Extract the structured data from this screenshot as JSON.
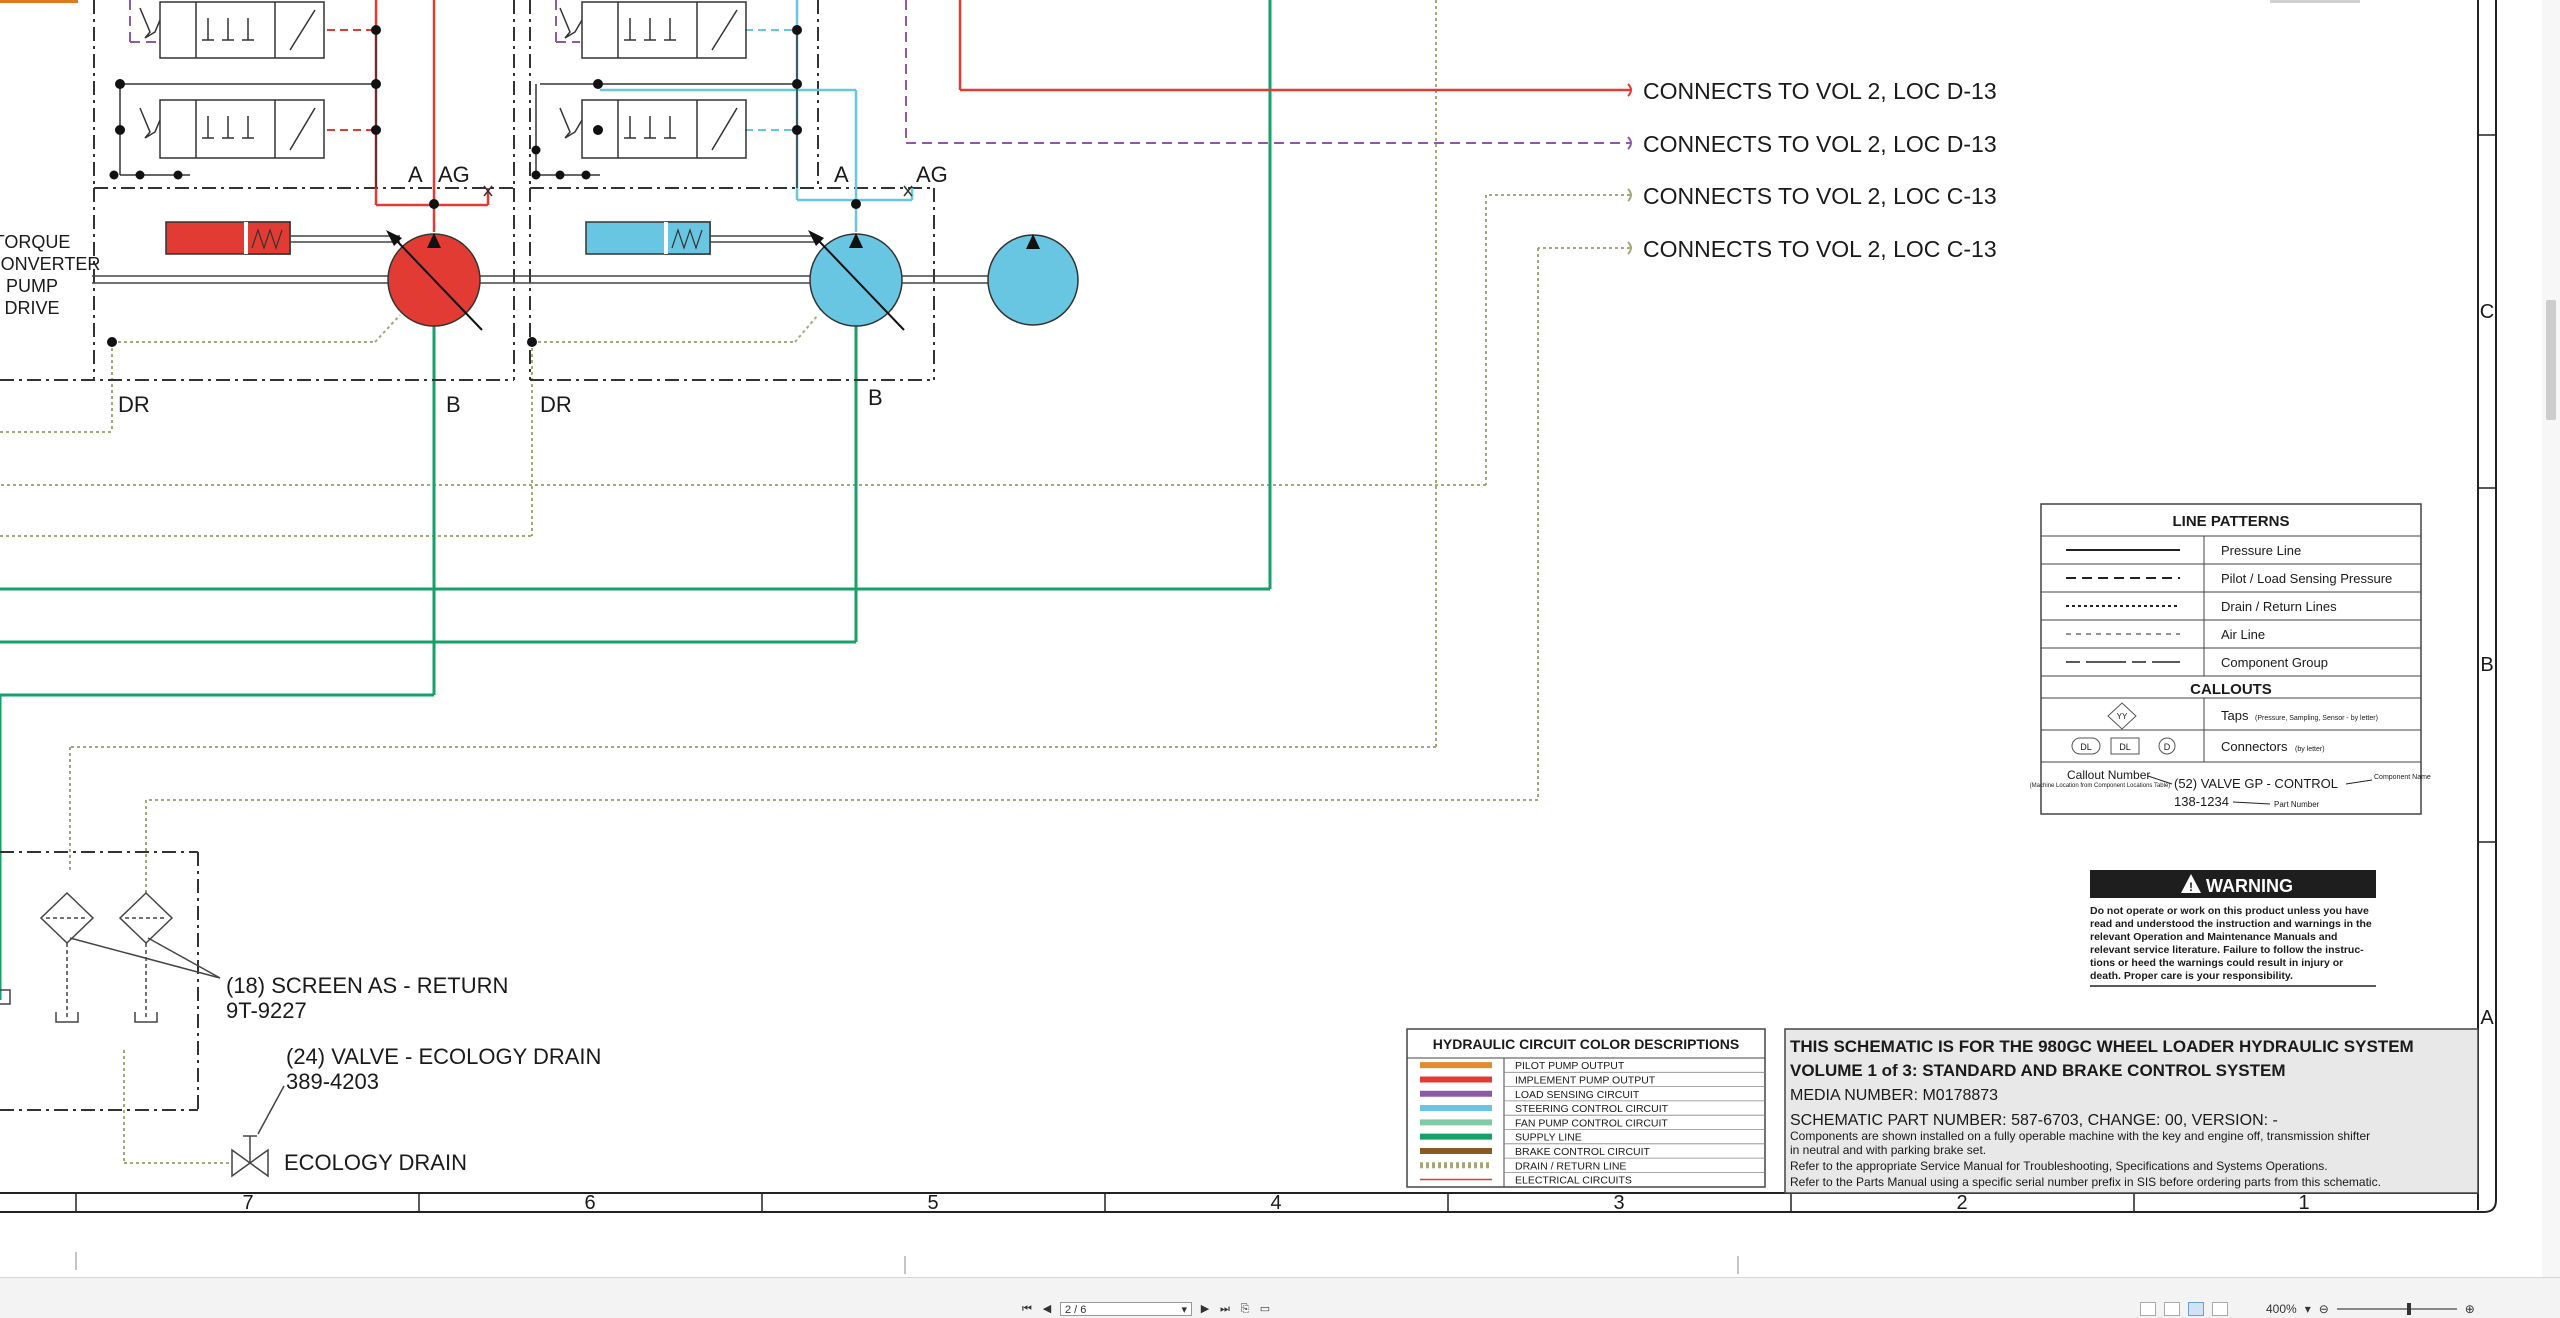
{
  "connects": [
    "CONNECTS TO VOL 2, LOC D-13",
    "CONNECTS TO VOL 2, LOC D-13",
    "CONNECTS TO VOL 2, LOC C-13",
    "CONNECTS TO VOL 2, LOC C-13"
  ],
  "ports": {
    "a1": "A",
    "ag1": "AG",
    "a2": "A",
    "ag2": "AG",
    "dr1": "DR",
    "dr2": "DR",
    "b1": "B",
    "b2": "B"
  },
  "torque": [
    "TORQUE",
    "CONVERTER",
    "PUMP",
    "DRIVE"
  ],
  "screen": {
    "name": "(18) SCREEN AS - RETURN",
    "part": "9T-9227"
  },
  "ecology_valve": {
    "name": "(24) VALVE - ECOLOGY DRAIN",
    "part": "389-4203"
  },
  "ecology_drain": "ECOLOGY DRAIN",
  "line_patterns": {
    "title": "LINE PATTERNS",
    "items": [
      "Pressure Line",
      "Pilot / Load Sensing Pressure",
      "Drain / Return Lines",
      "Air Line",
      "Component Group"
    ],
    "callouts_title": "CALLOUTS",
    "taps_label": "Taps",
    "taps_note": "(Pressure, Sampling, Sensor - by letter)",
    "taps_symbol": "YY",
    "connectors_label": "Connectors",
    "connectors_note": "(by letter)",
    "conn_symbols": [
      "DL",
      "DL",
      "D"
    ],
    "callout_number": "Callout Number",
    "callout_note": "(Machine Location from Component Locations Table)",
    "callout_example": "(52) VALVE GP - CONTROL",
    "callout_part": "138-1234",
    "component_name": "Component Name",
    "part_number": "Part Number"
  },
  "warning": {
    "title": "WARNING",
    "lines": [
      "Do not operate or work on this product unless you have",
      "read and understood the instruction and warnings in the",
      "relevant Operation and Maintenance Manuals and",
      "relevant service literature. Failure to follow the instruc-",
      "tions or heed the warnings could result in injury or",
      "death. Proper care is your responsibility."
    ]
  },
  "color_desc": {
    "title": "HYDRAULIC CIRCUIT COLOR DESCRIPTIONS",
    "items": [
      {
        "label": "PILOT PUMP OUTPUT",
        "color": "#e8892b",
        "style": "solid"
      },
      {
        "label": "IMPLEMENT PUMP OUTPUT",
        "color": "#e23b33",
        "style": "solid"
      },
      {
        "label": "LOAD SENSING CIRCUIT",
        "color": "#8e5aa8",
        "style": "solid"
      },
      {
        "label": "STEERING CONTROL CIRCUIT",
        "color": "#69c6e2",
        "style": "solid"
      },
      {
        "label": "FAN PUMP CONTROL CIRCUIT",
        "color": "#86c9a6",
        "style": "solid"
      },
      {
        "label": "SUPPLY LINE",
        "color": "#16a06a",
        "style": "solid"
      },
      {
        "label": "BRAKE CONTROL CIRCUIT",
        "color": "#8a5a22",
        "style": "solid"
      },
      {
        "label": "DRAIN / RETURN LINE",
        "color": "#a5a77a",
        "style": "dotted"
      },
      {
        "label": "ELECTRICAL CIRCUITS",
        "color": "#e23b33",
        "style": "thin"
      }
    ]
  },
  "title_block": {
    "line1": "THIS SCHEMATIC IS FOR THE 980GC WHEEL LOADER HYDRAULIC SYSTEM",
    "line2": "VOLUME 1 of 3: STANDARD AND BRAKE CONTROL SYSTEM",
    "media": "MEDIA NUMBER: M0178873",
    "part": "SCHEMATIC PART NUMBER: 587-6703, CHANGE: 00, VERSION: -",
    "note1": "Components are shown installed on a fully operable machine with the key and engine off, transmission shifter",
    "note2": "in neutral and with parking brake set.",
    "note3": "Refer to the appropriate Service Manual for Troubleshooting, Specifications and Systems Operations.",
    "note4": "Refer to the Parts Manual using a specific serial number prefix in SIS before ordering parts from this schematic."
  },
  "grid": {
    "columns": [
      "7",
      "6",
      "5",
      "4",
      "3",
      "2",
      "1"
    ],
    "rows": [
      "C",
      "B",
      "A"
    ]
  },
  "colors": {
    "implement": "#e23b33",
    "steering": "#69c6e2",
    "load_sensing": "#8e5aa8",
    "supply": "#16a06a",
    "drain": "#a5a77a"
  },
  "viewer": {
    "page": "2 / 6",
    "zoom": "400%"
  }
}
